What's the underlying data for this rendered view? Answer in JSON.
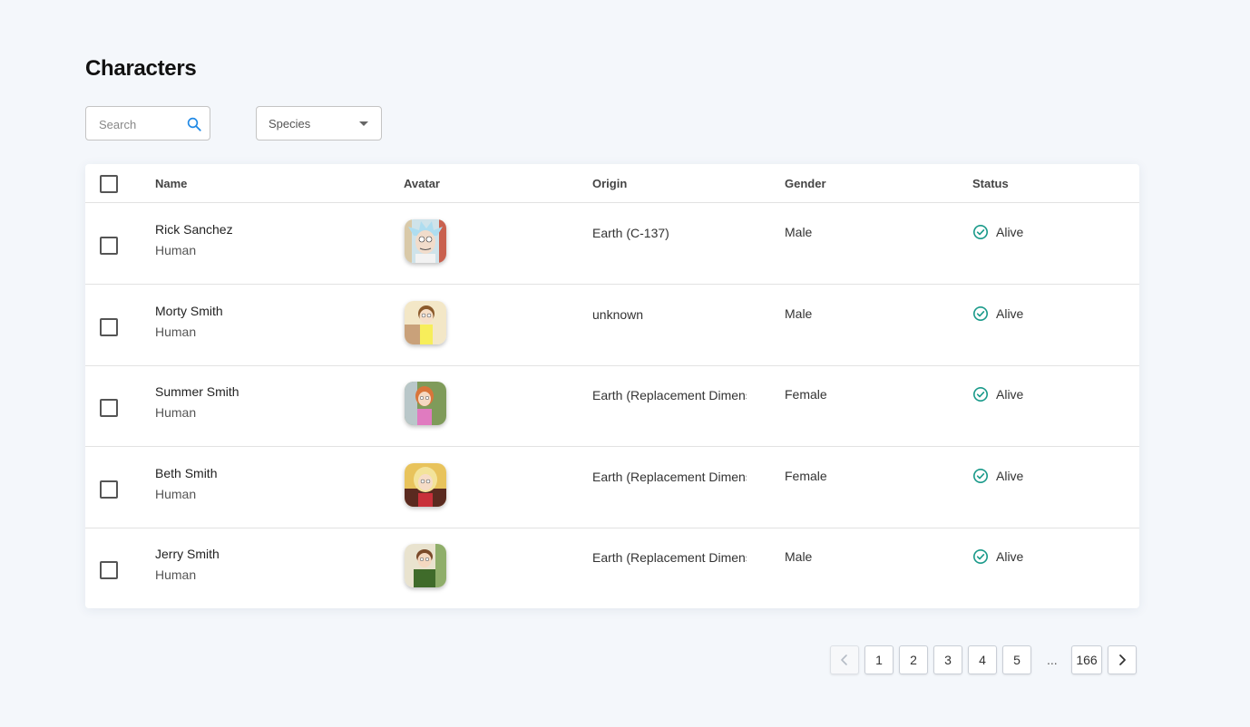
{
  "page": {
    "title": "Characters"
  },
  "filters": {
    "search_placeholder": "Search",
    "species_label": "Species"
  },
  "table": {
    "columns": [
      "Name",
      "Avatar",
      "Origin",
      "Gender",
      "Status"
    ],
    "rows": [
      {
        "name": "Rick Sanchez",
        "species": "Human",
        "origin": "Earth (C-137)",
        "gender": "Male",
        "status": "Alive"
      },
      {
        "name": "Morty Smith",
        "species": "Human",
        "origin": "unknown",
        "gender": "Male",
        "status": "Alive"
      },
      {
        "name": "Summer Smith",
        "species": "Human",
        "origin": "Earth (Replacement Dimens...",
        "gender": "Female",
        "status": "Alive"
      },
      {
        "name": "Beth Smith",
        "species": "Human",
        "origin": "Earth (Replacement Dimens...",
        "gender": "Female",
        "status": "Alive"
      },
      {
        "name": "Jerry Smith",
        "species": "Human",
        "origin": "Earth (Replacement Dimens...",
        "gender": "Male",
        "status": "Alive"
      }
    ]
  },
  "pagination": {
    "pages": [
      "1",
      "2",
      "3",
      "4",
      "5"
    ],
    "ellipsis": "...",
    "last_page": "166"
  },
  "colors": {
    "status_alive": "#1a9a8a",
    "search_icon": "#1e88e5",
    "background": "#f4f7fb"
  }
}
